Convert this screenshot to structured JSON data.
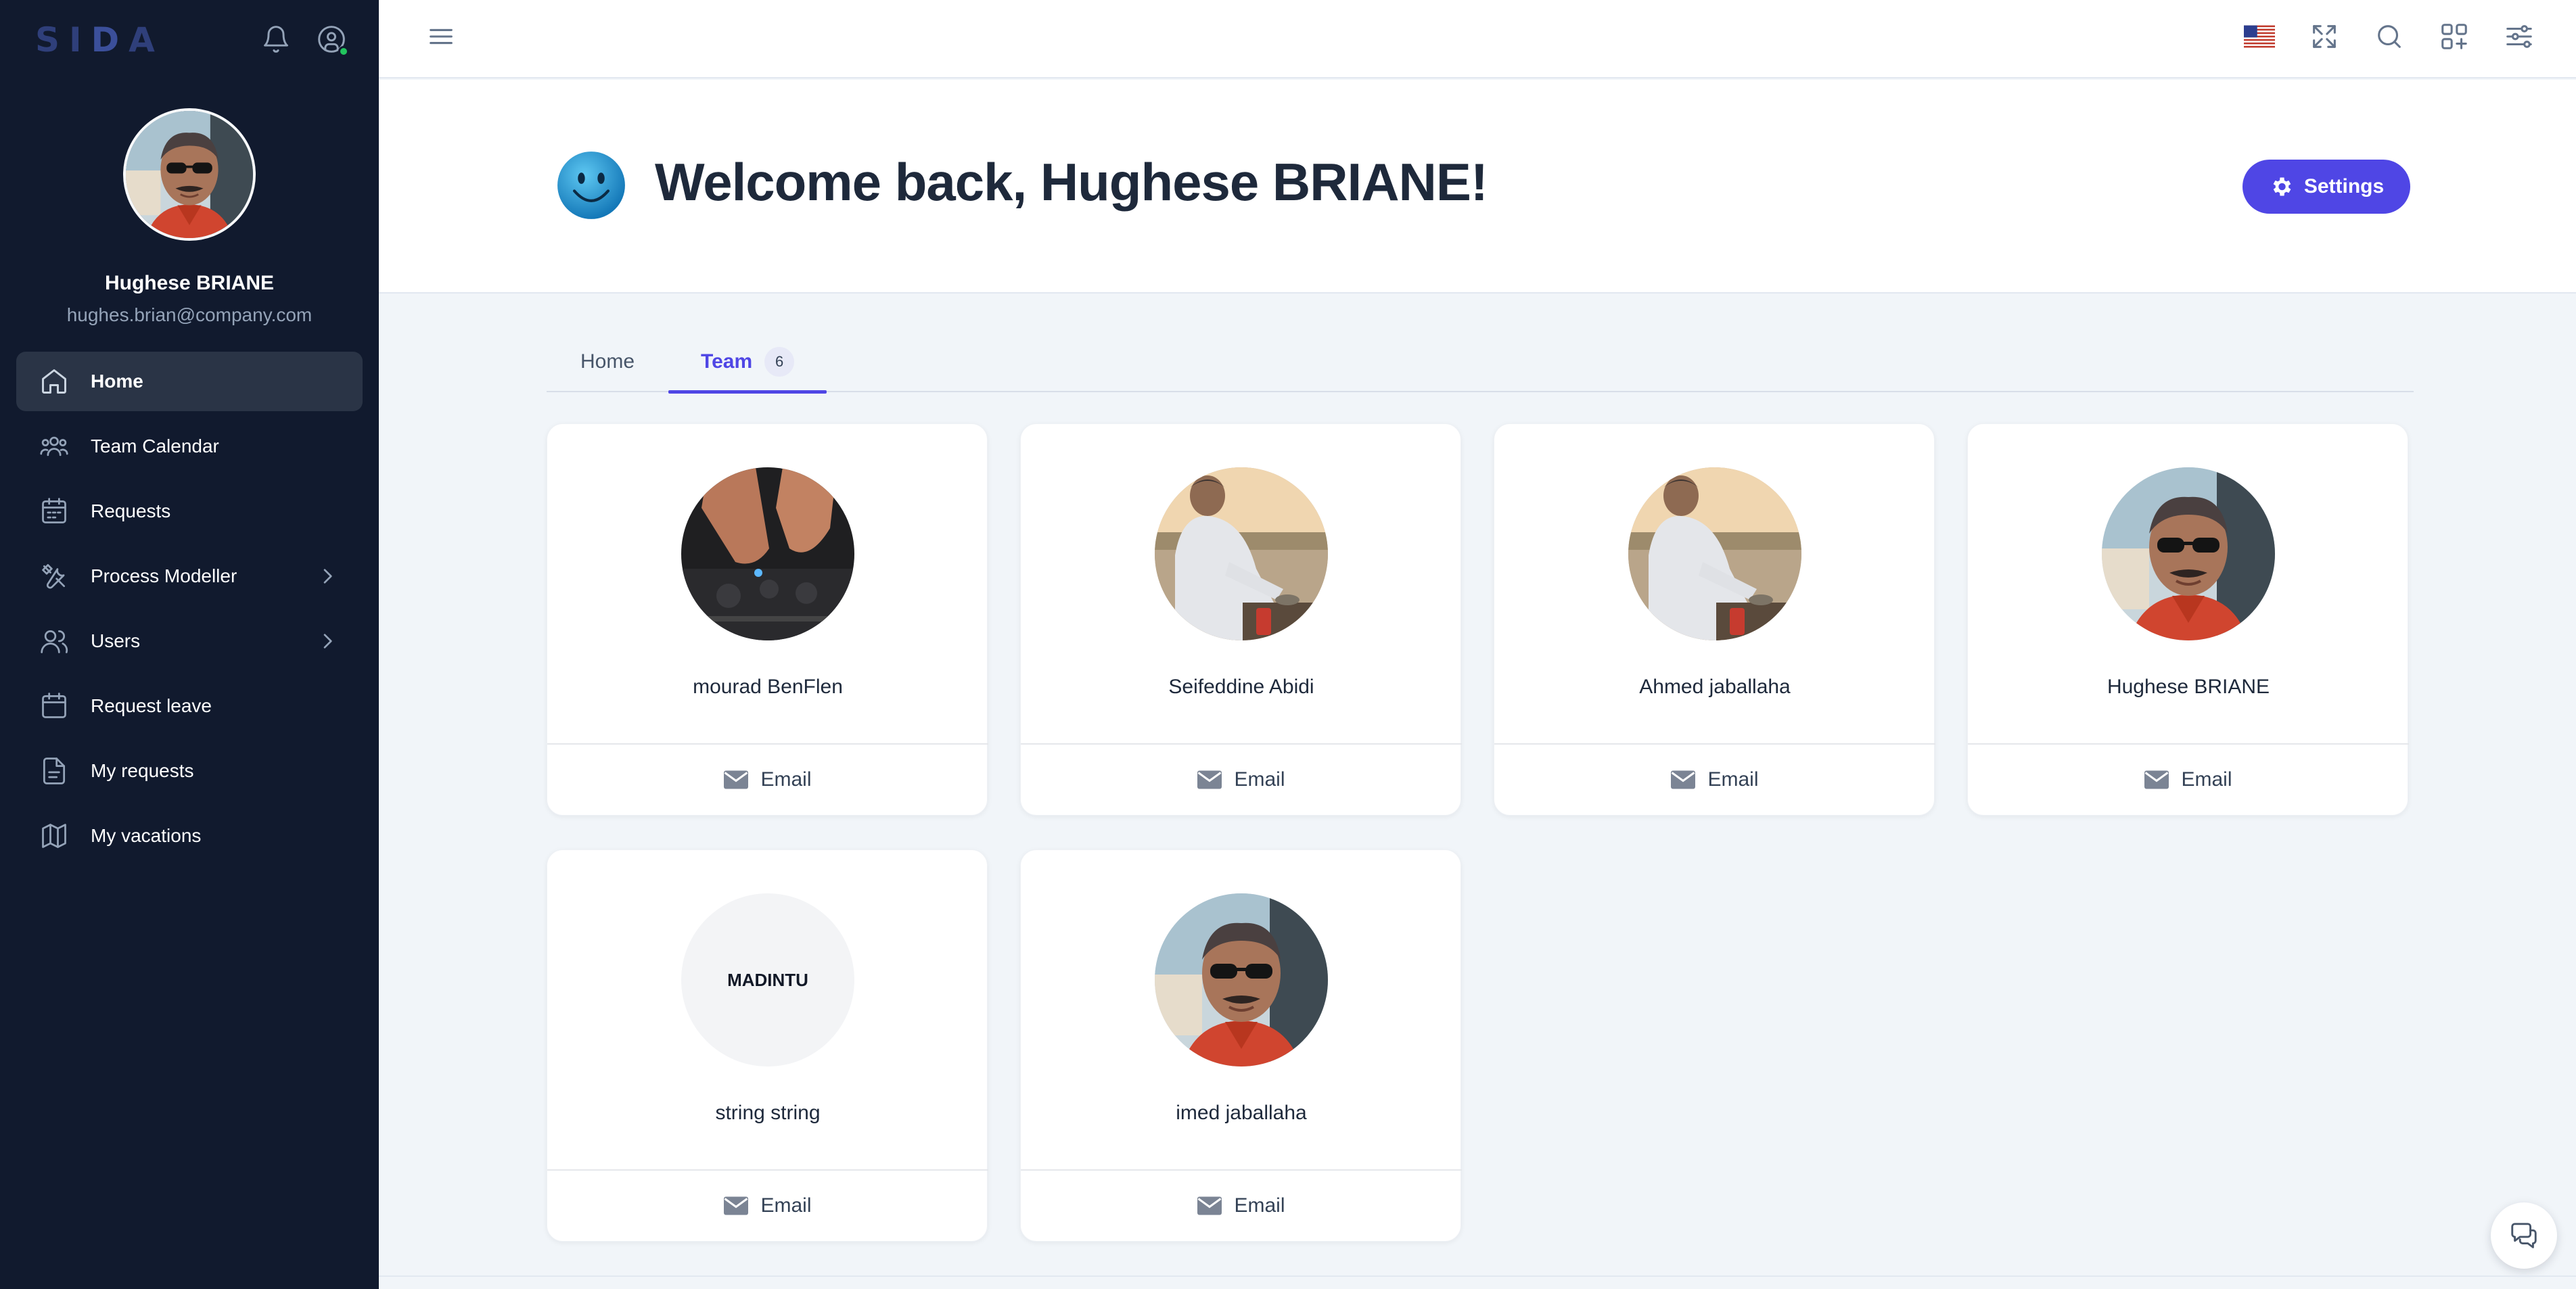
{
  "app": {
    "logo_left": "SI",
    "logo_mid": "D",
    "logo_right": "A"
  },
  "sidebar": {
    "user": {
      "name": "Hughese BRIANE",
      "email": "hughes.brian@company.com",
      "status": "online"
    },
    "items": [
      {
        "label": "Home",
        "icon": "home-icon",
        "active": true
      },
      {
        "label": "Team Calendar",
        "icon": "team-icon"
      },
      {
        "label": "Requests",
        "icon": "calendar-grid-icon"
      },
      {
        "label": "Process Modeller",
        "icon": "tools-icon",
        "has_submenu": true
      },
      {
        "label": "Users",
        "icon": "users-icon",
        "has_submenu": true
      },
      {
        "label": "Request leave",
        "icon": "calendar-icon"
      },
      {
        "label": "My requests",
        "icon": "document-icon"
      },
      {
        "label": "My vacations",
        "icon": "map-icon"
      }
    ]
  },
  "topbar": {
    "icons": [
      "hamburger-menu-icon",
      "us-flag-icon",
      "fullscreen-icon",
      "search-icon",
      "apps-add-icon",
      "sliders-icon"
    ]
  },
  "header": {
    "welcome": "Welcome back, Hughese BRIANE!",
    "settings_label": "Settings"
  },
  "tabs": [
    {
      "label": "Home",
      "active": false
    },
    {
      "label": "Team",
      "count": "6",
      "active": true
    }
  ],
  "team": {
    "members": [
      {
        "name": "mourad BenFlen",
        "action": "Email"
      },
      {
        "name": "Seifeddine Abidi",
        "action": "Email"
      },
      {
        "name": "Ahmed jaballaha",
        "action": "Email"
      },
      {
        "name": "Hughese BRIANE",
        "action": "Email"
      },
      {
        "name": "string string",
        "initials": "MADINTU",
        "action": "Email"
      },
      {
        "name": "imed jaballaha",
        "action": "Email"
      }
    ]
  },
  "colors": {
    "sidebar_bg": "#111a2e",
    "accent": "#4f46e5",
    "page_bg": "#f1f5f9",
    "online": "#22c55e"
  }
}
